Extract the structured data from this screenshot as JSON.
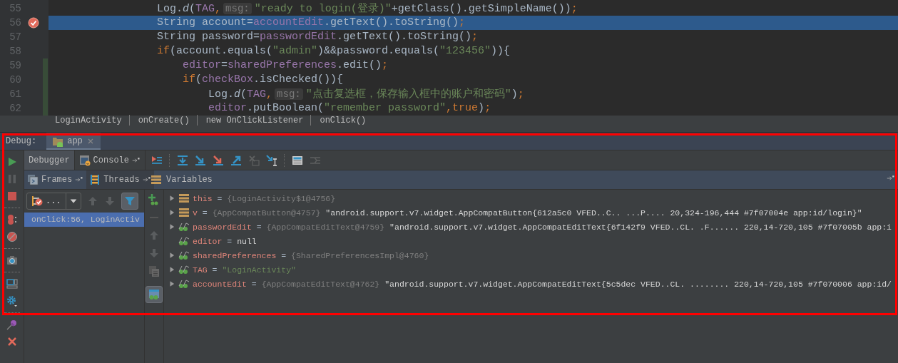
{
  "editor": {
    "lines": [
      {
        "number": "55",
        "breakpoint": false,
        "highlighted": false,
        "changed": false,
        "segments": [
          {
            "kind": "plain",
            "text": "Log."
          },
          {
            "kind": "method",
            "text": "d"
          },
          {
            "kind": "plain",
            "text": "("
          },
          {
            "kind": "field",
            "text": "TAG"
          },
          {
            "kind": "punct",
            "text": ","
          },
          {
            "kind": "hint",
            "text": "msg:"
          },
          {
            "kind": "string",
            "text": "\"ready to login(登录)\""
          },
          {
            "kind": "plain",
            "text": "+getClass().getSimpleName())"
          },
          {
            "kind": "punct",
            "text": ";"
          }
        ]
      },
      {
        "number": "56",
        "breakpoint": true,
        "highlighted": true,
        "changed": false,
        "segments": [
          {
            "kind": "plain",
            "text": "String account="
          },
          {
            "kind": "field",
            "text": "accountEdit"
          },
          {
            "kind": "plain",
            "text": ".getText().toString()"
          },
          {
            "kind": "punct",
            "text": ";"
          }
        ]
      },
      {
        "number": "57",
        "breakpoint": false,
        "highlighted": false,
        "changed": false,
        "segments": [
          {
            "kind": "plain",
            "text": "String password="
          },
          {
            "kind": "field",
            "text": "passwordEdit"
          },
          {
            "kind": "plain",
            "text": ".getText().toString()"
          },
          {
            "kind": "punct",
            "text": ";"
          }
        ]
      },
      {
        "number": "58",
        "breakpoint": false,
        "highlighted": false,
        "changed": false,
        "segments": [
          {
            "kind": "keyword",
            "text": "if"
          },
          {
            "kind": "plain",
            "text": "(account.equals("
          },
          {
            "kind": "string",
            "text": "\"admin\""
          },
          {
            "kind": "plain",
            "text": ")&&password.equals("
          },
          {
            "kind": "string",
            "text": "\"123456\""
          },
          {
            "kind": "plain",
            "text": ")){"
          }
        ],
        "children": [
          {
            "number": "59",
            "breakpoint": false,
            "highlighted": false,
            "changed": true,
            "segments": [
              {
                "kind": "field",
                "text": "editor"
              },
              {
                "kind": "plain",
                "text": "="
              },
              {
                "kind": "field",
                "text": "sharedPreferences"
              },
              {
                "kind": "plain",
                "text": ".edit()"
              },
              {
                "kind": "punct",
                "text": ";"
              }
            ]
          },
          {
            "number": "60",
            "breakpoint": false,
            "highlighted": false,
            "changed": true,
            "segments": [
              {
                "kind": "keyword",
                "text": "if"
              },
              {
                "kind": "plain",
                "text": "("
              },
              {
                "kind": "field",
                "text": "checkBox"
              },
              {
                "kind": "plain",
                "text": ".isChecked()){"
              }
            ],
            "children": [
              {
                "number": "61",
                "breakpoint": false,
                "highlighted": false,
                "changed": true,
                "segments": [
                  {
                    "kind": "plain",
                    "text": "Log."
                  },
                  {
                    "kind": "method",
                    "text": "d"
                  },
                  {
                    "kind": "plain",
                    "text": "("
                  },
                  {
                    "kind": "field",
                    "text": "TAG"
                  },
                  {
                    "kind": "punct",
                    "text": ","
                  },
                  {
                    "kind": "hint",
                    "text": "msg:"
                  },
                  {
                    "kind": "string",
                    "text": "\"点击复选框，保存输入框中的账户和密码\""
                  },
                  {
                    "kind": "plain",
                    "text": ")"
                  },
                  {
                    "kind": "punct",
                    "text": ";"
                  }
                ]
              },
              {
                "number": "62",
                "breakpoint": false,
                "highlighted": false,
                "changed": true,
                "segments": [
                  {
                    "kind": "field",
                    "text": "editor"
                  },
                  {
                    "kind": "plain",
                    "text": ".putBoolean("
                  },
                  {
                    "kind": "string",
                    "text": "\"remember password\""
                  },
                  {
                    "kind": "punct",
                    "text": ","
                  },
                  {
                    "kind": "keyword",
                    "text": "true"
                  },
                  {
                    "kind": "plain",
                    "text": ")"
                  },
                  {
                    "kind": "punct",
                    "text": ";"
                  }
                ]
              }
            ]
          }
        ]
      }
    ]
  },
  "breadcrumbs": [
    "LoginActivity",
    "onCreate()",
    "new OnClickListener",
    "onClick()"
  ],
  "debug": {
    "label": "Debug:",
    "sessions": [
      {
        "title": "app",
        "selected": true
      }
    ],
    "tabs": [
      {
        "label": "Debugger",
        "selected": true
      },
      {
        "label": "Console",
        "selected": false
      }
    ],
    "frames_tabs": [
      {
        "label": "Frames",
        "selected": true
      },
      {
        "label": "Threads",
        "selected": false
      }
    ],
    "thread_selector": {
      "value": "..."
    },
    "frames": [
      {
        "label": "onClick:56, LoginActiv",
        "selected": true
      }
    ],
    "variables": {
      "title": "Variables",
      "items": [
        {
          "name": "this",
          "kind": "object",
          "expandable": true,
          "operator": "=",
          "ref": "{LoginActivity$1@4756}"
        },
        {
          "name": "v",
          "kind": "object",
          "expandable": true,
          "operator": "=",
          "ref": "{AppCompatButton@4757}",
          "value": "\"android.support.v7.widget.AppCompatButton{612a5c0 VFED..C.. ...P.... 20,324-196,444 #7f07004e app:id/login}\"",
          "is_string": false
        },
        {
          "name": "passwordEdit",
          "kind": "field",
          "expandable": true,
          "operator": "=",
          "ref": "{AppCompatEditText@4759}",
          "value": "\"android.support.v7.widget.AppCompatEditText{6f142f9 VFED..CL. .F...... 220,14-720,105 #7f07005b app:i",
          "is_string": false
        },
        {
          "name": "editor",
          "kind": "field",
          "expandable": false,
          "operator": "=",
          "value": "null",
          "is_string": false
        },
        {
          "name": "sharedPreferences",
          "kind": "field",
          "expandable": true,
          "operator": "=",
          "ref": "{SharedPreferencesImpl@4760}"
        },
        {
          "name": "TAG",
          "kind": "field",
          "expandable": true,
          "operator": "=",
          "value": "\"LoginActivity\"",
          "is_string": true
        },
        {
          "name": "accountEdit",
          "kind": "field",
          "expandable": true,
          "operator": "=",
          "ref": "{AppCompatEditText@4762}",
          "value": "\"android.support.v7.widget.AppCompatEditText{5c5dec VFED..CL. ........ 220,14-720,105 #7f070006 app:id/",
          "is_string": false
        }
      ]
    }
  }
}
